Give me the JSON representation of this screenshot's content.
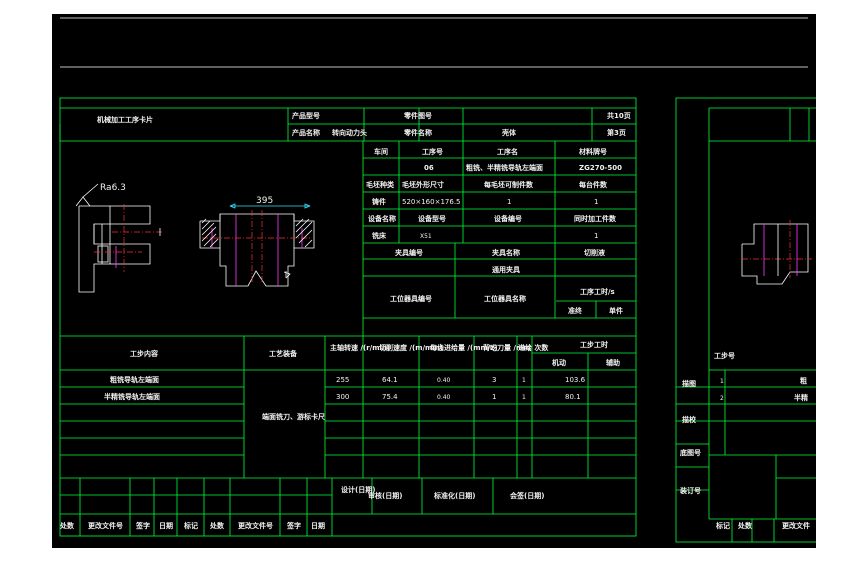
{
  "colors": {
    "background": "#000000",
    "frame": "#00ff3c",
    "text": "#f2f2f2",
    "drawing_white": "#ffffff",
    "drawing_magenta": "#ff3cff",
    "drawing_red": "#ff3030",
    "drawing_cyan": "#37e0ff"
  },
  "header": {
    "title": "机械加工工序卡片",
    "product_model_label": "产品型号",
    "product_name_label": "产品名称",
    "product_name_value": "转向动力头",
    "part_no_label": "零件图号",
    "part_name_label": "零件名称",
    "part_name_value": "壳体",
    "total_pages": "共10页",
    "page_no": "第3页"
  },
  "process_info": {
    "headers": [
      "车间",
      "工序号",
      "工序名",
      "材料牌号"
    ],
    "values": [
      "",
      "06",
      "粗铣、半精铣导轨左端面",
      "ZG270-500"
    ],
    "blank_headers": [
      "毛坯种类",
      "毛坯外形尺寸",
      "每毛坯可制件数",
      "每台件数"
    ],
    "blank_values": [
      "铸件",
      "520×160×176.5",
      "1",
      "1"
    ],
    "equip_headers": [
      "设备名称",
      "设备型号",
      "设备编号",
      "同时加工件数"
    ],
    "equip_values": [
      "铣床",
      "X51",
      "",
      "1"
    ],
    "fixture_headers": [
      "夹具编号",
      "夹具名称",
      "切削液"
    ],
    "fixture_values": [
      "",
      "通用夹具",
      ""
    ],
    "station_tool_no": "工位器具编号",
    "station_tool_name": "工位器具名称",
    "time_label": "工序工时/s",
    "time_sub": [
      "准终",
      "单件"
    ]
  },
  "drawing": {
    "roughness_label": "Ra6.3",
    "dimension_label": "395"
  },
  "steps": {
    "col_step": "工步内容",
    "col_equipment": "工艺装备",
    "col_speed": "主轴转速\n/(r/min)",
    "col_cut_speed": "切削速度\n/(m/min)",
    "col_feed": "每齿进给量\n/(mm/z)",
    "col_depth": "背吃刀量\n/mm",
    "col_passes": "进给\n次数",
    "col_time": "工步工时",
    "col_time_sub": [
      "机动",
      "辅助"
    ],
    "rows": [
      {
        "content": "粗铣导轨左端面",
        "speed": "255",
        "cut_speed": "64.1",
        "feed": "0.40",
        "depth": "3",
        "passes": "1",
        "machine": "103.6"
      },
      {
        "content": "半精铣导轨左端面",
        "speed": "300",
        "cut_speed": "75.4",
        "feed": "0.40",
        "depth": "1",
        "passes": "1",
        "machine": "80.1"
      }
    ],
    "equipment": "端面铣刀、游标卡尺"
  },
  "signoff": {
    "labels": [
      "设计(日期)",
      "审核(日期)",
      "标准化(日期)",
      "会签(日期)"
    ],
    "bottom": [
      "处数",
      "更改文件号",
      "签字",
      "日期",
      "标记",
      "处数",
      "更改文件号",
      "签字",
      "日期"
    ]
  },
  "right_sheet": {
    "step_label": "工步号",
    "side": [
      "描图",
      "描校",
      "底图号",
      "装订号"
    ],
    "row_nums": [
      "1",
      "2"
    ],
    "row_text": [
      "粗",
      "半精"
    ],
    "bottom": [
      "标记",
      "处数",
      "更改文件"
    ]
  }
}
